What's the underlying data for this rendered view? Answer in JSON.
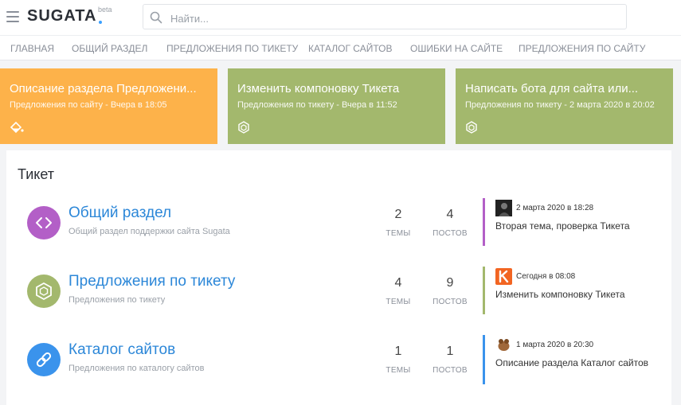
{
  "header": {
    "logo": "SUGATA",
    "beta": "beta",
    "search_placeholder": "Найти..."
  },
  "nav": [
    "ГЛАВНАЯ",
    "ОБЩИЙ РАЗДЕЛ",
    "ПРЕДЛОЖЕНИЯ ПО ТИКЕТУ",
    "КАТАЛОГ САЙТОВ",
    "ОШИБКИ НА САЙТЕ",
    "ПРЕДЛОЖЕНИЯ ПО САЙТУ"
  ],
  "featured": [
    {
      "title": "Описание раздела Предложени...",
      "sub": "Предложения по сайту - Вчера в 18:05",
      "color": "#fdb24a",
      "icon": "paint-bucket-icon"
    },
    {
      "title": "Изменить компоновку Тикета",
      "sub": "Предложения по тикету - Вчера в 11:52",
      "color": "#a3b86d",
      "icon": "hexagon-icon"
    },
    {
      "title": "Написать бота для сайта или...",
      "sub": "Предложения по тикету - 2 марта 2020 в 20:02",
      "color": "#a3b86d",
      "icon": "hexagon-icon"
    }
  ],
  "section": {
    "title": "Тикет",
    "themes_label": "ТЕМЫ",
    "posts_label": "ПОСТОВ",
    "forums": [
      {
        "name": "Общий раздел",
        "desc": "Общий раздел поддержки сайта Sugata",
        "themes": "2",
        "posts": "4",
        "color": "#b35fc7",
        "icon": "code-brackets-icon",
        "last_time": "2 марта 2020 в 18:28",
        "last_title": "Вторая тема, проверка Тикета"
      },
      {
        "name": "Предложения по тикету",
        "desc": "Предложения по тикету",
        "themes": "4",
        "posts": "9",
        "color": "#a3b86d",
        "icon": "hexagon-icon",
        "last_time": "Сегодня в 08:08",
        "last_title": "Изменить компоновку Тикета"
      },
      {
        "name": "Каталог сайтов",
        "desc": "Предложения по каталогу сайтов",
        "themes": "1",
        "posts": "1",
        "color": "#3a93ec",
        "icon": "link-icon",
        "last_time": "1 марта 2020 в 20:30",
        "last_title": "Описание раздела Каталог сайтов"
      }
    ]
  },
  "colors": {
    "accent": "#2c87d8",
    "orange": "#fdb24a",
    "green": "#a3b86d",
    "purple": "#b35fc7",
    "blue": "#3a93ec"
  }
}
